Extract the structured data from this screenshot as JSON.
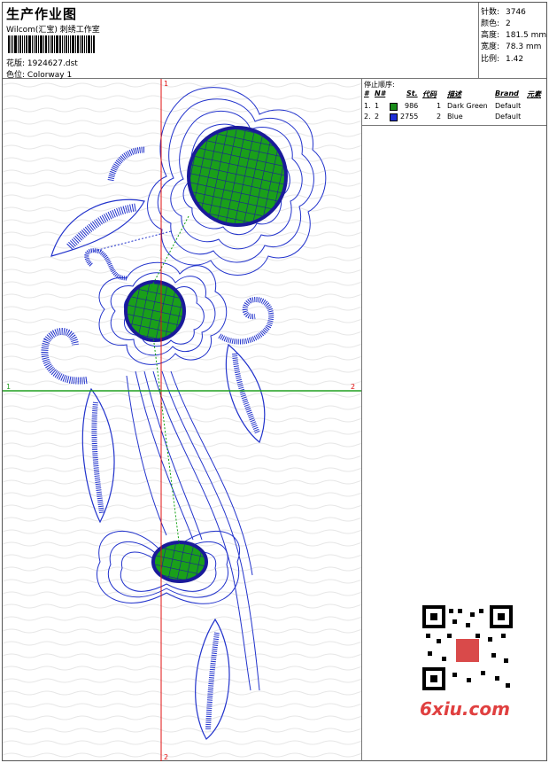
{
  "header": {
    "title": "生产作业图",
    "company": "Wilcom(汇宝) 刺绣工作室",
    "design_label": "花版:",
    "design_file": "1924627.dst",
    "colorway_label": "色位:",
    "colorway_name": "Colorway 1"
  },
  "stats": [
    {
      "label": "针数:",
      "value": "3746"
    },
    {
      "label": "颜色:",
      "value": "2"
    },
    {
      "label": "高度:",
      "value": "181.5 mm"
    },
    {
      "label": "宽度:",
      "value": "78.3 mm"
    },
    {
      "label": "比例:",
      "value": "1.42"
    }
  ],
  "stop_sequence": {
    "title": "停止顺序:",
    "columns": [
      "#",
      "N#",
      "St.",
      "代码",
      "描述",
      "Brand",
      "元素"
    ],
    "rows": [
      {
        "idx": "1.",
        "n": "1",
        "stitches": "986",
        "code": "1",
        "desc": "Dark Green",
        "brand": "Default",
        "color": "#1a8c1a"
      },
      {
        "idx": "2.",
        "n": "2",
        "stitches": "2755",
        "code": "2",
        "desc": "Blue",
        "brand": "Default",
        "color": "#1f2fd6"
      }
    ]
  },
  "canvas": {
    "axis_labels": {
      "top": "1",
      "bottom": "2",
      "left": "1",
      "right": "2"
    },
    "axis_color": "#e01010",
    "hline_color": "#20a020",
    "thread_blue": "#2233cc",
    "thread_green": "#10a010"
  },
  "watermark": {
    "site": "6xiu.com"
  }
}
